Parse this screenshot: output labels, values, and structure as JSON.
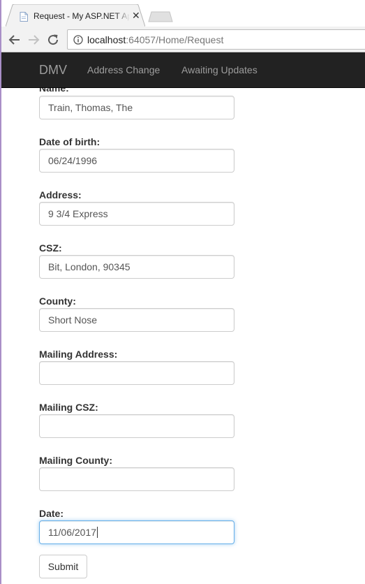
{
  "browser": {
    "tab": {
      "title": "Request - My ASP.NET Application",
      "favicon": "page-icon",
      "close": "✕"
    },
    "url": {
      "host": "localhost",
      "path": ":64057/Home/Request"
    }
  },
  "navbar": {
    "brand": "DMV",
    "links": [
      "Address Change",
      "Awaiting Updates"
    ]
  },
  "form": {
    "fields": [
      {
        "label": "Name:",
        "value": "Train, Thomas, The"
      },
      {
        "label": "Date of birth:",
        "value": "06/24/1996"
      },
      {
        "label": "Address:",
        "value": "9 3/4 Express"
      },
      {
        "label": "CSZ:",
        "value": "Bit, London, 90345"
      },
      {
        "label": "County:",
        "value": "Short Nose"
      },
      {
        "label": "Mailing Address:",
        "value": ""
      },
      {
        "label": "Mailing CSZ:",
        "value": ""
      },
      {
        "label": "Mailing County:",
        "value": ""
      },
      {
        "label": "Date:",
        "value": "11/06/2017"
      }
    ],
    "submit_label": "Submit"
  },
  "colors": {
    "navbar_bg": "#222222",
    "nav_text": "#9d9d9d",
    "focus": "#66afe9"
  }
}
